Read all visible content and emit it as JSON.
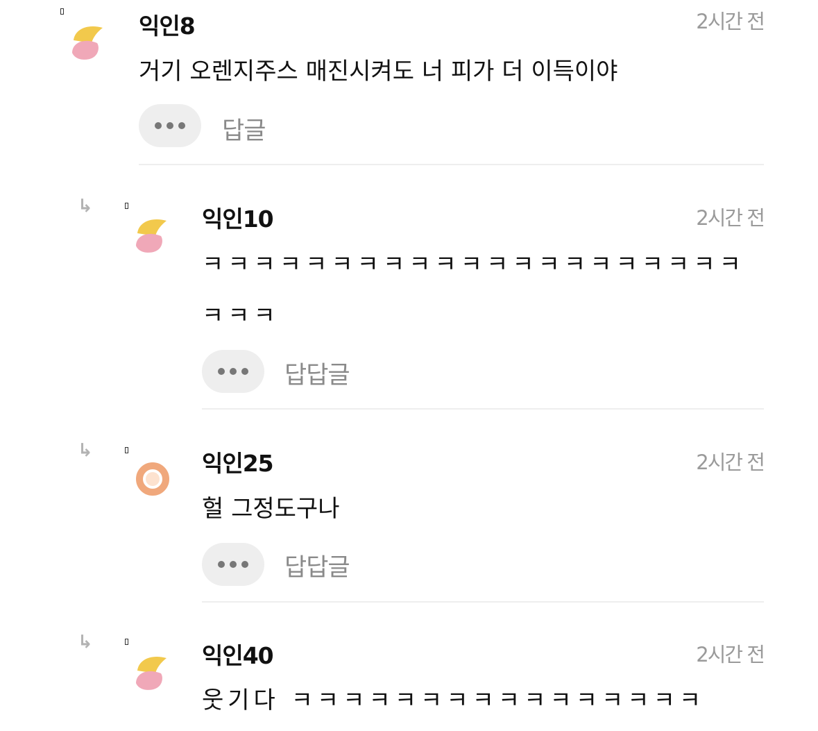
{
  "comments": [
    {
      "name": "익인8",
      "time": "2시간 전",
      "lines": [
        "거기 오렌지주스 매진시켜도 너 피가 더 이득이야"
      ],
      "reply_label": "답글",
      "avatar": "half-moon-avatar-icon",
      "avatar_colors": {
        "top": "#f2c94c",
        "bottom": "#f0a8b8"
      }
    },
    {
      "name": "익인10",
      "time": "2시간 전",
      "lines": [
        "ㅋㅋㅋㅋㅋㅋㅋㅋㅋㅋㅋㅋㅋㅋㅋㅋㅋㅋㅋㅋㅋ",
        "ㅋㅋㅋ"
      ],
      "reply_label": "답답글",
      "avatar": "half-moon-avatar-icon",
      "avatar_colors": {
        "top": "#f2c94c",
        "bottom": "#f0a8b8"
      }
    },
    {
      "name": "익인25",
      "time": "2시간 전",
      "lines": [
        "헐 그정도구나"
      ],
      "reply_label": "답답글",
      "avatar": "ring-avatar-icon",
      "avatar_colors": {
        "ring": "#f0a87c",
        "center": "#fde2cf"
      }
    },
    {
      "name": "익인40",
      "time": "2시간 전",
      "lines": [
        "웃기다 ㅋㅋㅋㅋㅋㅋㅋㅋㅋㅋㅋㅋㅋㅋㅋㅋ"
      ],
      "avatar": "half-moon-avatar-icon",
      "avatar_colors": {
        "top": "#f2c94c",
        "bottom": "#f0a8b8"
      }
    }
  ],
  "icons": {
    "reply_arrow": "reply-arrow-icon",
    "more": "more-dots-icon"
  }
}
